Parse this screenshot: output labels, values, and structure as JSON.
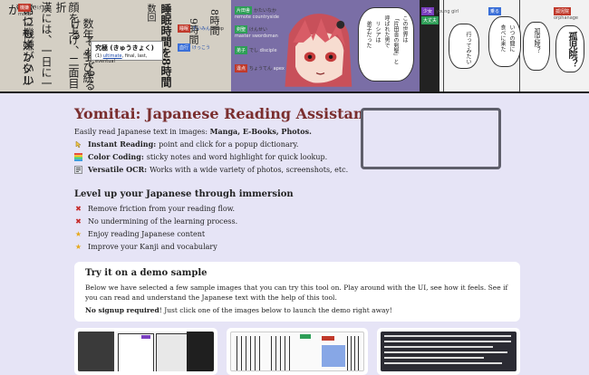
{
  "banner": {
    "panel1": {
      "vertical_lines": [
        "いつもメンタルが",
        "常に機嫌がいい",
        "漢には、一日に一",
        "顔を上げ、二面目折",
        "数年、学び続ける",
        "それでやる"
      ],
      "labels": [
        {
          "tag": "機嫌",
          "reading": "きげん",
          "gloss": "mood",
          "color": "#c0392b"
        },
        {
          "tag": "睡眠",
          "reading": "すいみん",
          "gloss": "sleep",
          "color": "#c0392b"
        },
        {
          "tag": "血行",
          "reading": "けっこう",
          "gloss": "",
          "color": "#3a6fd8"
        }
      ],
      "dict": {
        "headword": "究極 (きゅうきょく)",
        "definition_prefix": "(1)",
        "definition_link": "ultimate",
        "definition_rest": ", final, last, eventual"
      },
      "side_text": [
        "数回",
        "睡眠時間を8時間",
        "9時間",
        "8時間"
      ]
    },
    "panel2": {
      "labels": [
        {
          "tag": "片田舎",
          "reading": "かたいなか",
          "gloss": "remote countryside",
          "color": "#2e9e57"
        },
        {
          "tag": "剣聖",
          "reading": "けんせい",
          "gloss": "master swordsman",
          "color": "#2e9e57"
        },
        {
          "tag": "弟子",
          "reading": "でし",
          "gloss": "disciple",
          "color": "#2e9e57"
        },
        {
          "tag": "違点",
          "reading": "ちょうてん",
          "gloss": "apex",
          "color": "#c0392b"
        }
      ],
      "bubble_lines": [
        "この世界は",
        "「片田舎の剣聖」と",
        "呼ばれた男で",
        "リシアは",
        "弟子だった"
      ]
    },
    "panel3": {
      "labels": [
        {
          "tag": "少女",
          "reading": "",
          "gloss": "young girl",
          "color": "#7a3fbf"
        },
        {
          "tag": "大丈夫",
          "reading": "",
          "gloss": "",
          "color": "#2e9e57"
        },
        {
          "tag": "乗る",
          "reading": "",
          "gloss": "",
          "color": "#3a6fd8"
        },
        {
          "tag": "孤児院",
          "reading": "",
          "gloss": "orphanage",
          "color": "#c0392b"
        }
      ],
      "bubble_lines": [
        "孤児院？",
        "いつの間に",
        "食べに来た",
        "行ってみたい"
      ]
    }
  },
  "page": {
    "title": "Yomitai: Japanese Reading Assistant",
    "intro_prefix": "Easily read Japanese text in images: ",
    "intro_bold": "Manga, E-Books, Photos.",
    "features": [
      {
        "icon": "pointer-icon",
        "bold": "Instant Reading:",
        "text": "point and click for a popup dictionary."
      },
      {
        "icon": "color-stripes-icon",
        "bold": "Color Coding:",
        "text": "sticky notes and word highlight for quick lookup."
      },
      {
        "icon": "ocr-icon",
        "bold": "Versatile OCR:",
        "text": "Works with a wide variety of photos, screenshots, etc."
      }
    ],
    "immersion_heading": "Level up your Japanese through immersion",
    "immersion_items": [
      {
        "icon": "cross-icon",
        "text": "Remove friction from your reading flow."
      },
      {
        "icon": "cross-icon",
        "text": "No undermining of the learning process."
      },
      {
        "icon": "star-icon",
        "text": "Enjoy reading Japanese content"
      },
      {
        "icon": "star-icon",
        "text": "Improve your Kanji and vocabulary"
      }
    ]
  },
  "demo": {
    "heading": "Try it on a demo sample",
    "paragraph": "Below we have selected a few sample images that you can try this tool on. Play around with the UI, see how it feels. See if you can read and understand the Japanese text with the help of this tool.",
    "no_signup_bold": "No signup required",
    "no_signup_rest": "! Just click one of the images below to launch the demo right away!"
  },
  "colors": {
    "background": "#e6e4f6",
    "title": "#7a2e2e",
    "cross": "#c62b2b",
    "star": "#e6a81c",
    "video_border": "#5e5e6a"
  }
}
